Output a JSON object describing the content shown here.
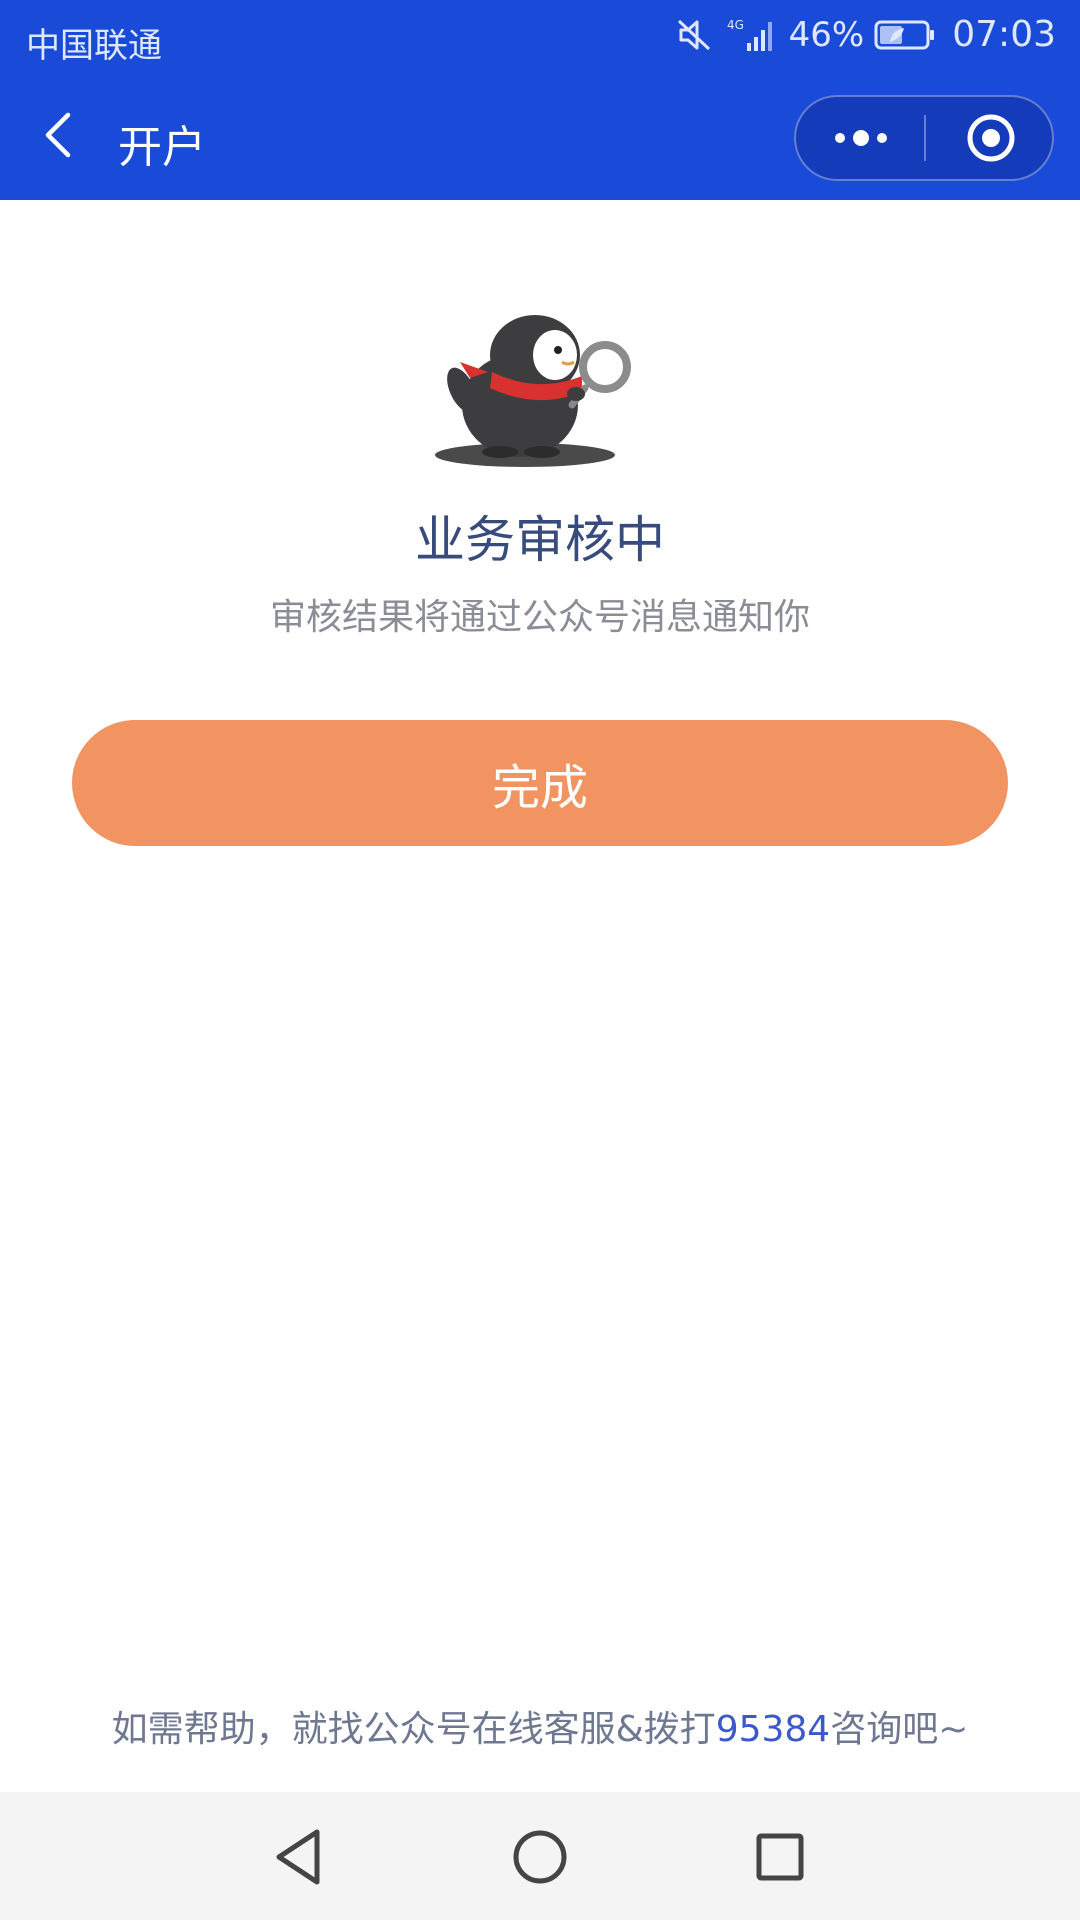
{
  "status_bar": {
    "carrier": "中国联通",
    "network": "4G",
    "battery": "46%",
    "time": "07:03"
  },
  "nav": {
    "title": "开户",
    "icons": {
      "back": "chevron-left-icon",
      "more": "more-dots-icon",
      "close": "target-circle-icon"
    }
  },
  "content": {
    "mascot": "penguin-magnifier-illustration",
    "title": "业务审核中",
    "subtitle": "审核结果将通过公众号消息通知你",
    "done_button": "完成"
  },
  "footer": {
    "help_prefix": "如需帮助，就找公众号在线客服&拨打",
    "phone": "95384",
    "help_suffix": "咨询吧~"
  },
  "colors": {
    "header": "#1a4bd8",
    "button": "#f29461",
    "title": "#384b7d",
    "link": "#3b59c8"
  }
}
